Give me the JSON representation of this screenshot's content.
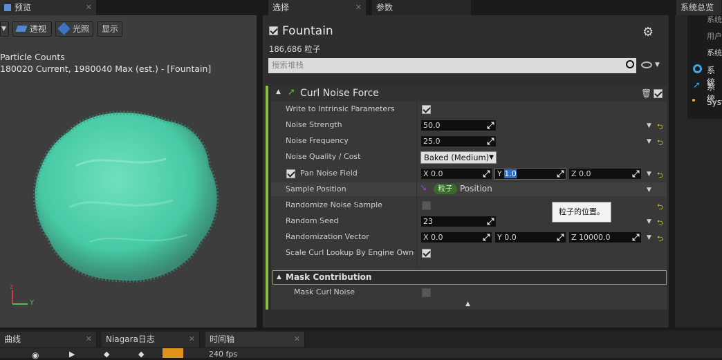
{
  "preview_tab": {
    "label": "预览"
  },
  "selection_tab": {
    "label": "选择"
  },
  "params_tab": {
    "label": "参数"
  },
  "overview_tab": {
    "label": "系统总览"
  },
  "viewport": {
    "perspective_label": "透视",
    "lit_label": "光照",
    "show_label": "显示",
    "stats_title": "Particle Counts",
    "stats_line": "180020 Current, 1980040 Max (est.) - [Fountain]",
    "axis_z": "z",
    "axis_y": "Y"
  },
  "selection": {
    "title": "Fountain",
    "particle_count": "186,686 粒子",
    "search_placeholder": "搜索堆栈"
  },
  "module": {
    "title": "Curl Noise Force",
    "rows": [
      {
        "label": "Write to Intrinsic Parameters"
      },
      {
        "label": "Noise Strength",
        "value": "50.0"
      },
      {
        "label": "Noise Frequency",
        "value": "25.0"
      },
      {
        "label": "Noise Quality / Cost",
        "value": "Baked (Medium)"
      },
      {
        "label": "Pan Noise Field",
        "x": "X 0.0",
        "y_prefix": "Y ",
        "y_value": "1.0",
        "z": "Z 0.0"
      },
      {
        "label": "Sample Position",
        "tag": "粒子",
        "value": "Position"
      },
      {
        "label": "Randomize Noise Sample"
      },
      {
        "label": "Random Seed",
        "value": "23"
      },
      {
        "label": "Randomization Vector",
        "x": "X 0.0",
        "y": "Y 0.0",
        "z": "Z 10000.0"
      },
      {
        "label": "Scale Curl Lookup By Engine Owner S"
      }
    ],
    "tooltip": "粒子的位置。",
    "mask_header": "Mask Contribution",
    "mask_row": "Mask Curl Noise"
  },
  "overview": {
    "items": [
      "系统",
      "用户",
      "系统",
      "系统",
      "系统",
      "Syst"
    ]
  },
  "bottom_tabs": [
    "曲线",
    "Niagara日志",
    "时间轴"
  ],
  "bottom_fps": "240 fps"
}
